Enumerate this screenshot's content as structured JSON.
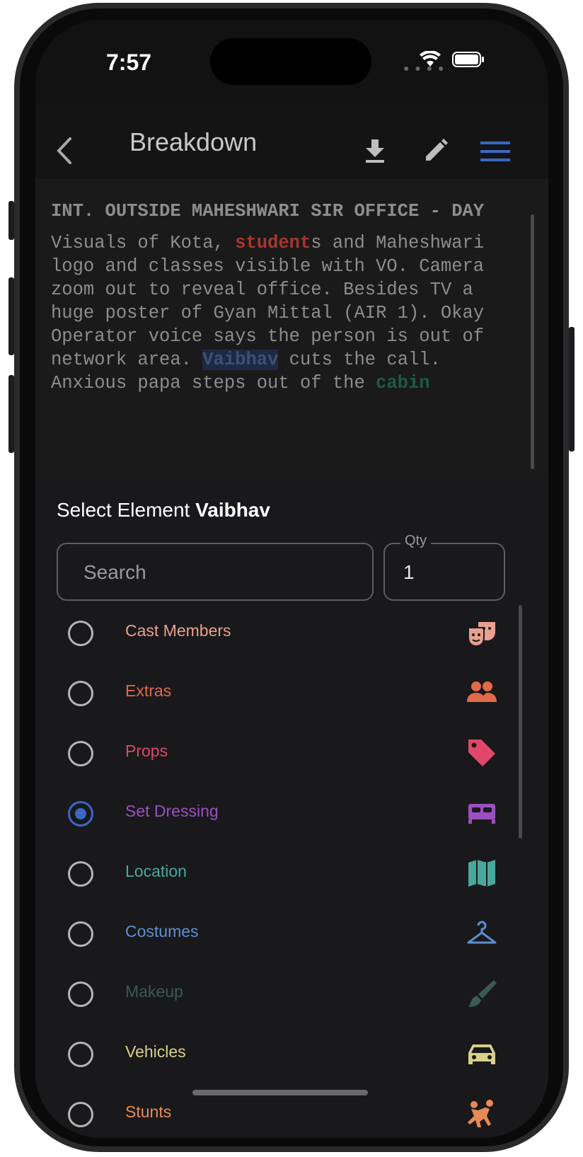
{
  "status": {
    "time": "7:57"
  },
  "appbar": {
    "title": "Breakdown",
    "icons": [
      "back-chevron-icon",
      "download-icon",
      "edit-pencil-icon",
      "menu-icon"
    ]
  },
  "script": {
    "heading": "INT. OUTSIDE MAHESHWARI SIR OFFICE - DAY",
    "seg1": "Visuals of Kota, ",
    "hl1": "student",
    "seg2": "s and Maheshwari logo and classes visible with VO. Camera zoom out to reveal office. Besides TV a huge poster of Gyan Mittal (AIR 1). Okay Operator voice says the person is out of network area. ",
    "hl2": "Vaibhav",
    "seg3": " cuts the call. Anxious papa steps out of the ",
    "hl3": "cabin"
  },
  "sheet": {
    "title_prefix": "Select Element",
    "title_name": "Vaibhav",
    "search_placeholder": "Search",
    "qty_label": "Qty",
    "qty_value": "1"
  },
  "categories": [
    {
      "label": "Cast Members",
      "color": "#e8a090",
      "icon": "theater-masks-icon",
      "selected": false
    },
    {
      "label": "Extras",
      "color": "#e06a4a",
      "icon": "people-group-icon",
      "selected": false
    },
    {
      "label": "Props",
      "color": "#e0476a",
      "icon": "tag-icon",
      "selected": false
    },
    {
      "label": "Set Dressing",
      "color": "#9b4fc0",
      "icon": "bed-icon",
      "selected": true
    },
    {
      "label": "Location",
      "color": "#4aa89a",
      "icon": "map-icon",
      "selected": false
    },
    {
      "label": "Costumes",
      "color": "#5a8fd0",
      "icon": "hanger-icon",
      "selected": false
    },
    {
      "label": "Makeup",
      "color": "#3a5a50",
      "icon": "brush-icon",
      "selected": false
    },
    {
      "label": "Vehicles",
      "color": "#d8cf8a",
      "icon": "car-icon",
      "selected": false
    },
    {
      "label": "Stunts",
      "color": "#e88a55",
      "icon": "stunt-fight-icon",
      "selected": false
    }
  ]
}
